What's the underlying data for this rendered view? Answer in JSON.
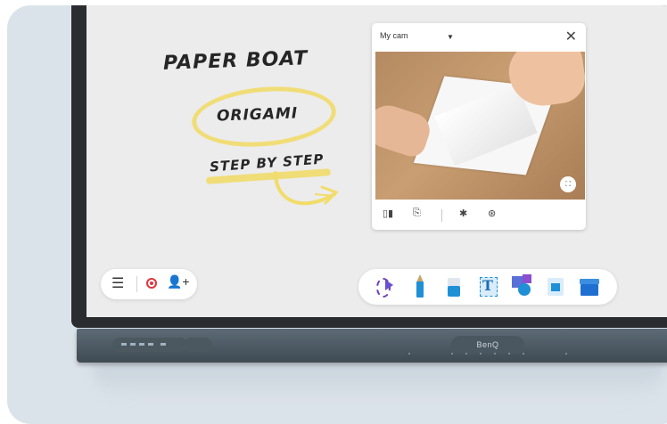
{
  "whiteboard": {
    "title": "PAPER BOAT",
    "subtitle": "ORIGAMI",
    "tagline": "STEP BY STEP",
    "highlight_color": "#f2dc6a"
  },
  "camera_panel": {
    "source_label": "My cam",
    "dropdown_icon": "caret-down-icon",
    "close_glyph": "✕",
    "fullscreen_glyph": "⛶",
    "tools": [
      {
        "name": "mirror-icon",
        "glyph": "▯▮"
      },
      {
        "name": "rotate-icon",
        "glyph": "⎘"
      },
      {
        "name": "freeze-icon",
        "glyph": "✱"
      },
      {
        "name": "aperture-icon",
        "glyph": "⊛"
      }
    ]
  },
  "left_toolbar": {
    "menu_glyph": "☰",
    "record_color": "#e0353d",
    "invite_glyph": "👤+"
  },
  "main_toolbar": {
    "tools": [
      "lasso-select",
      "pen",
      "eraser",
      "text-box",
      "shapes",
      "image",
      "toolbox"
    ],
    "accent": "#1f8fd6"
  },
  "right_toolbar": {
    "glyph": "◁"
  },
  "device": {
    "brand": "BenQ"
  }
}
